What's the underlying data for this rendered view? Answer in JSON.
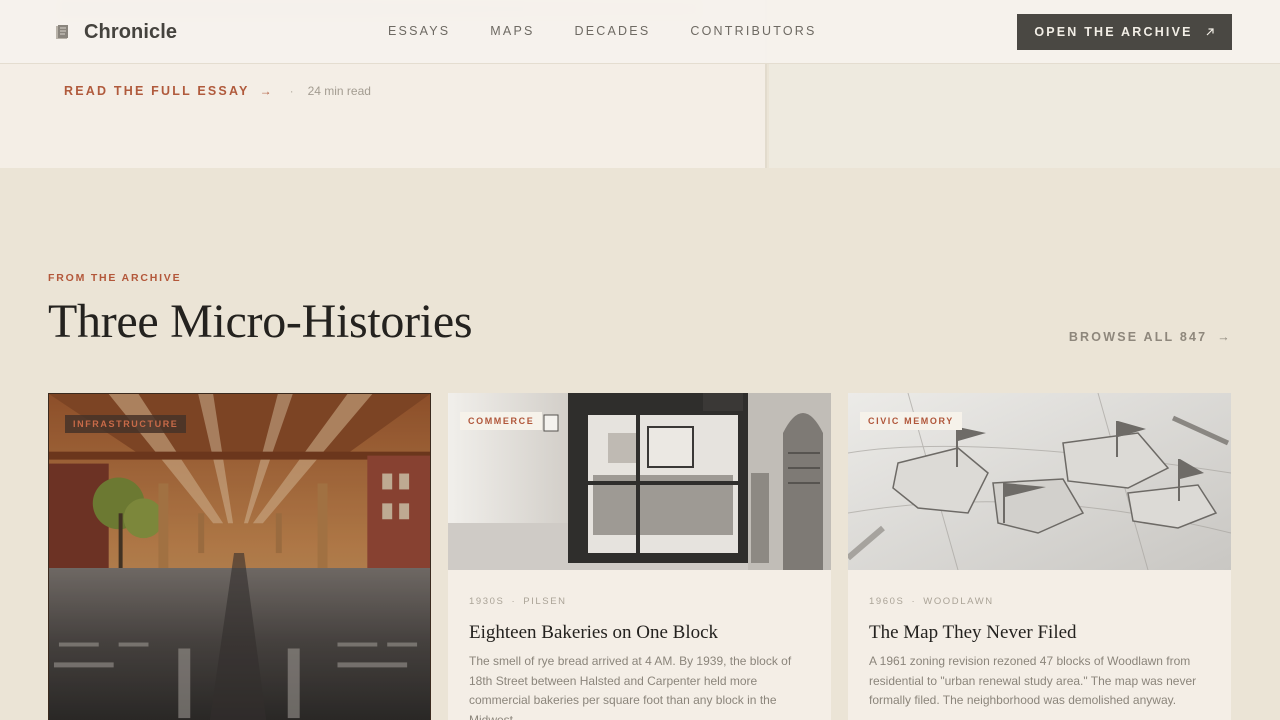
{
  "nav": {
    "brand": "Chronicle",
    "links": [
      "ESSAYS",
      "MAPS",
      "DECADES",
      "CONTRIBUTORS"
    ],
    "cta": "OPEN THE ARCHIVE"
  },
  "hero": {
    "read_link": "READ THE FULL ESSAY",
    "read_time": "24 min read"
  },
  "section": {
    "eyebrow": "FROM THE ARCHIVE",
    "title": "Three Micro-Histories",
    "browse": "BROWSE ALL 847"
  },
  "cards": [
    {
      "tag": "INFRASTRUCTURE"
    },
    {
      "tag": "COMMERCE",
      "decade": "1930S",
      "place": "PILSEN",
      "title": "Eighteen Bakeries on One Block",
      "desc": "The smell of rye bread arrived at 4 AM. By 1939, the block of 18th Street between Halsted and Carpenter held more commercial bakeries per square foot than any block in the Midwest."
    },
    {
      "tag": "CIVIC MEMORY",
      "decade": "1960S",
      "place": "WOODLAWN",
      "title": "The Map They Never Filed",
      "desc": "A 1961 zoning revision rezoned 47 blocks of Woodlawn from residential to \"urban renewal study area.\" The map was never formally filed. The neighborhood was demolished anyway."
    }
  ],
  "colors": {
    "accent": "#b05a3c",
    "cta_bg": "#4a4843",
    "section_bg": "#ebe4d6",
    "card_bg": "#f4eee6"
  }
}
